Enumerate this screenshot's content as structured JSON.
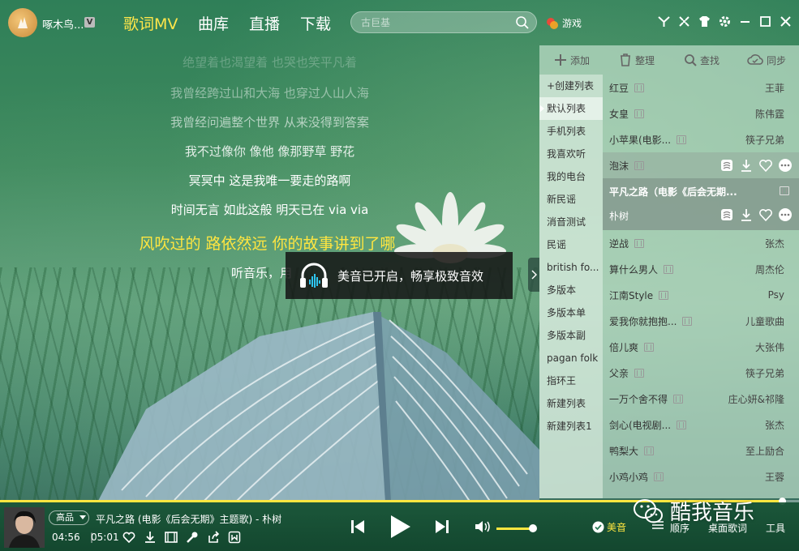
{
  "user": {
    "name": "啄木鸟...",
    "badge": "V"
  },
  "nav": [
    {
      "label": "歌词MV",
      "active": true
    },
    {
      "label": "曲库",
      "active": false
    },
    {
      "label": "直播",
      "active": false
    },
    {
      "label": "下载",
      "active": false
    }
  ],
  "search": {
    "placeholder": "古巨基"
  },
  "games": {
    "label": "游戏"
  },
  "lyrics": [
    "绝望着也渴望着 也哭也笑平凡着",
    "我曾经跨过山和大海 也穿过人山人海",
    "我曾经问遍整个世界 从来没得到答案",
    "我不过像你 像他 像那野草 野花",
    "冥冥中 这是我唯一要走的路啊",
    "时间无言 如此这般 明天已在 via via",
    "风吹过的 路依然远 你的故事讲到了哪",
    "听音乐，用"
  ],
  "current_lyric_index": 6,
  "toast": {
    "text": "美音已开启，畅享极致音效"
  },
  "toolbar": {
    "add": "添加",
    "organize": "整理",
    "find": "查找",
    "sync": "同步"
  },
  "playlists": [
    "+创建列表",
    "默认列表",
    "手机列表",
    "我喜欢听",
    "我的电台",
    "新民谣",
    "消音测试",
    "民谣",
    "british fo...",
    "多版本",
    "多版本单",
    "多版本副",
    "pagan folk",
    "指环王",
    "新建列表",
    "新建列表1"
  ],
  "active_playlist_index": 1,
  "songs": [
    {
      "title": "红豆",
      "artist": "王菲"
    },
    {
      "title": "女皇",
      "artist": "陈伟霆"
    },
    {
      "title": "小苹果(电影...",
      "artist": "筷子兄弟"
    },
    {
      "title": "泡沫",
      "artist": ""
    },
    {
      "title": "平凡之路（电影《后会无期...",
      "artist": "朴树"
    },
    {
      "title": "逆战",
      "artist": "张杰"
    },
    {
      "title": "算什么男人",
      "artist": "周杰伦"
    },
    {
      "title": "江南Style",
      "artist": "Psy"
    },
    {
      "title": "爱我你就抱抱...",
      "artist": "儿童歌曲"
    },
    {
      "title": "倍儿爽",
      "artist": "大张伟"
    },
    {
      "title": "父亲",
      "artist": "筷子兄弟"
    },
    {
      "title": "一万个舍不得",
      "artist": "庄心妍&祁隆"
    },
    {
      "title": "剑心(电视剧...",
      "artist": "张杰"
    },
    {
      "title": "鸭梨大",
      "artist": "至上励合"
    },
    {
      "title": "小鸡小鸡",
      "artist": "王蓉"
    }
  ],
  "player": {
    "quality": "高品",
    "now_playing": "平凡之路 (电影《后会无期》主题歌) - 朴树",
    "elapsed": "04:56",
    "duration": "05:01",
    "progress": 0.98,
    "volume": 0.88,
    "audio_effect": "美音",
    "order": "顺序",
    "desktop_lyrics": "桌面歌词",
    "tools": "工具"
  },
  "watermark": "酷我音乐",
  "colors": {
    "accent": "#ffe640",
    "panel": "#c3e1cd"
  }
}
